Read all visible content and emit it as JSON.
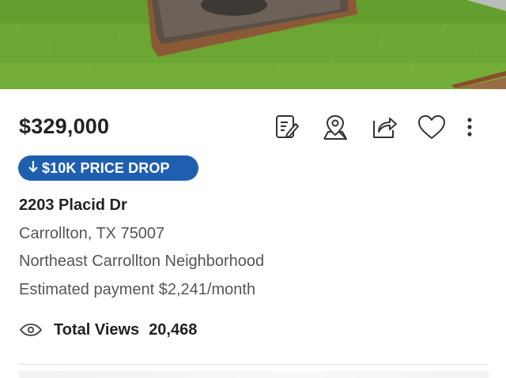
{
  "listing": {
    "price": "$329,000",
    "badge_label": "$10K PRICE DROP",
    "address": "2203 Placid Dr",
    "city_line": "Carrollton, TX 75007",
    "neighborhood": "Northeast Carrollton Neighborhood",
    "payment": "Estimated payment $2,241/month",
    "views_label": "Total Views",
    "views_count": "20,468"
  },
  "actions": [
    {
      "icon": "notes-icon"
    },
    {
      "icon": "map-pin-icon"
    },
    {
      "icon": "share-icon"
    },
    {
      "icon": "heart-icon"
    },
    {
      "icon": "more-vertical-icon"
    }
  ],
  "colors": {
    "badge": "#1f5fb0",
    "text_primary": "#222222",
    "text_secondary": "#555555",
    "grass": "#6ea834"
  }
}
